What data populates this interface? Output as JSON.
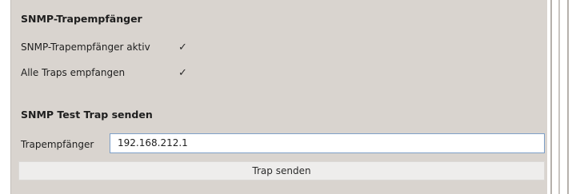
{
  "trap_receiver": {
    "heading": "SNMP-Trapempfänger",
    "active_label": "SNMP-Trapempfänger aktiv",
    "active_checked": true,
    "all_traps_label": "Alle Traps empfangen",
    "all_traps_checked": true,
    "check_glyph": "✓"
  },
  "test_trap": {
    "heading": "SNMP Test Trap senden",
    "receiver_label": "Trapempfänger",
    "receiver_value": "192.168.212.1",
    "send_label": "Trap senden"
  }
}
